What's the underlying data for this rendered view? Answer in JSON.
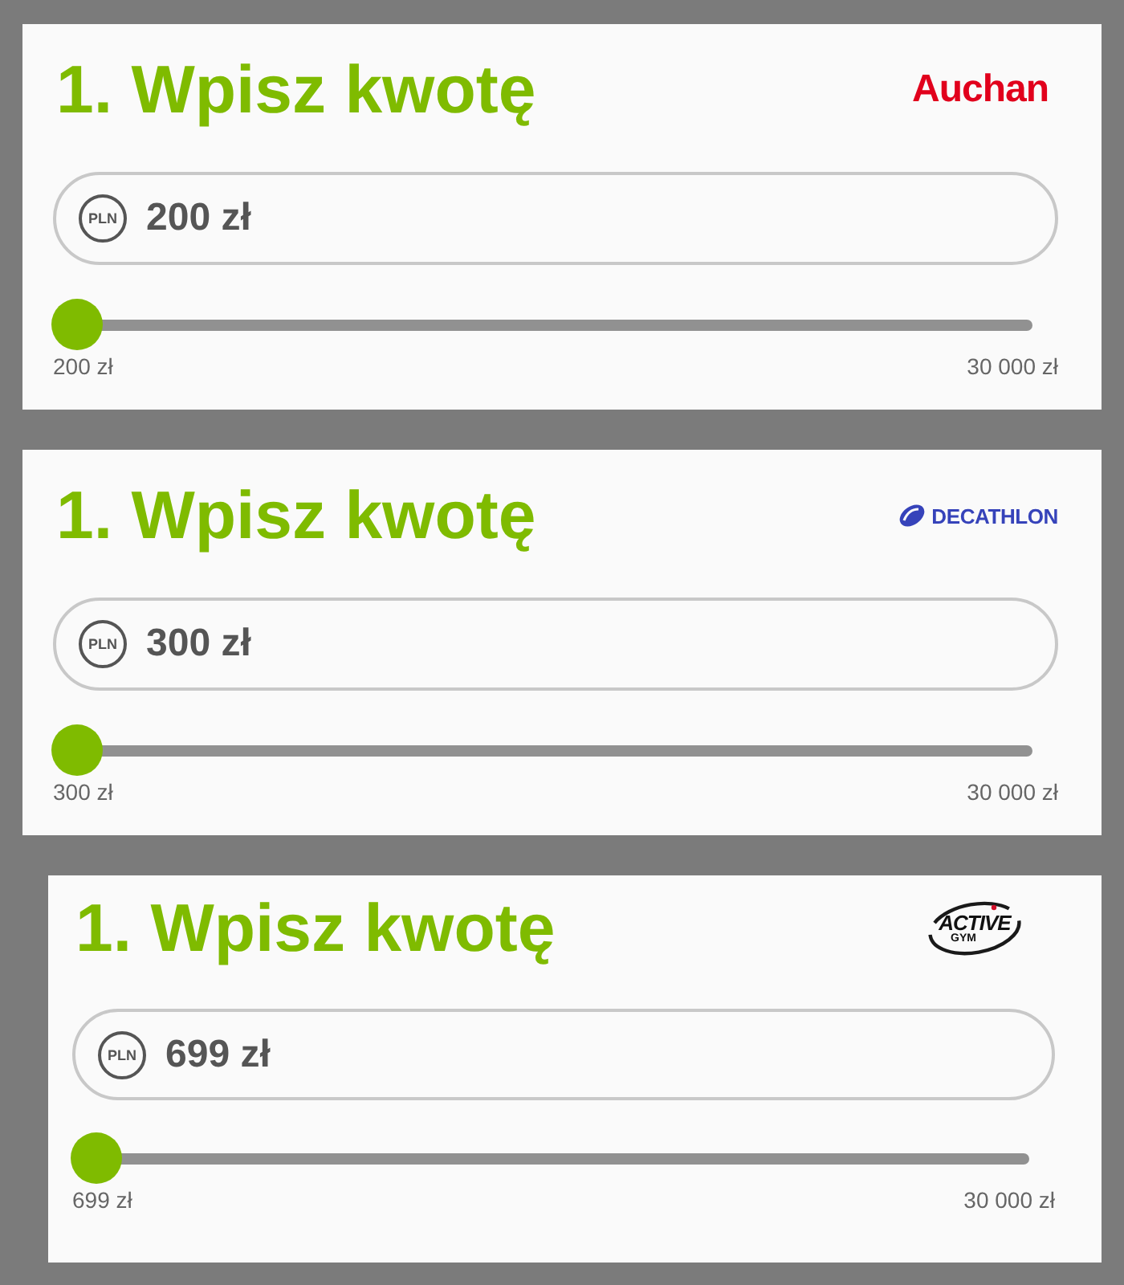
{
  "cards": [
    {
      "title": "1. Wpisz kwotę",
      "brand": {
        "kind": "auchan",
        "name": "Auchan"
      },
      "amount": {
        "currency": "PLN",
        "value": "200 zł"
      },
      "slider": {
        "level": 0,
        "min_label": "200 zł",
        "max_label": "30 000 zł"
      }
    },
    {
      "title": "1. Wpisz kwotę",
      "brand": {
        "kind": "decathlon",
        "name": "DECATHLON"
      },
      "amount": {
        "currency": "PLN",
        "value": "300 zł"
      },
      "slider": {
        "level": 0,
        "min_label": "300 zł",
        "max_label": "30 000 zł"
      }
    },
    {
      "title": "1. Wpisz kwotę",
      "brand": {
        "kind": "active_gym",
        "name": "ACTIVE",
        "tagline": "GYM"
      },
      "amount": {
        "currency": "PLN",
        "value": "699 zł"
      },
      "slider": {
        "level": 0,
        "min_label": "699 zł",
        "max_label": "30 000 zł"
      }
    }
  ]
}
